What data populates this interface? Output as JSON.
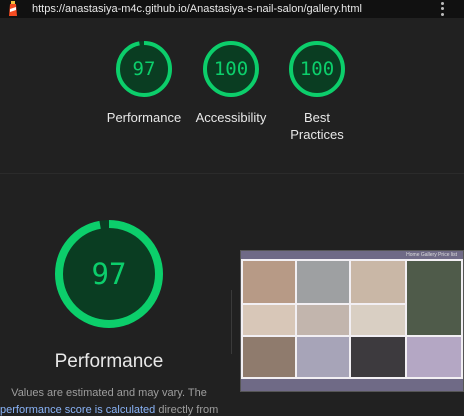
{
  "browser": {
    "url": "https://anastasiya-m4c.github.io/Anastasiya-s-nail-salon/gallery.html"
  },
  "summary_scores": [
    {
      "label": "Performance",
      "score": "97"
    },
    {
      "label": "Accessibility",
      "score": "100"
    },
    {
      "label": "Best Practices",
      "score": "100"
    }
  ],
  "performance": {
    "score": "97",
    "title": "Performance",
    "note_line1": "Values are estimated and may vary. The",
    "note_link": "performance score is calculated",
    "note_after_link": "directly from"
  },
  "screenshot": {
    "header_text": "Home Gallery Price list"
  },
  "colors": {
    "pass": "#0cce6b",
    "pass_bg": "#0a3d22",
    "link": "#8ab4f8",
    "page_bg": "#212121"
  }
}
